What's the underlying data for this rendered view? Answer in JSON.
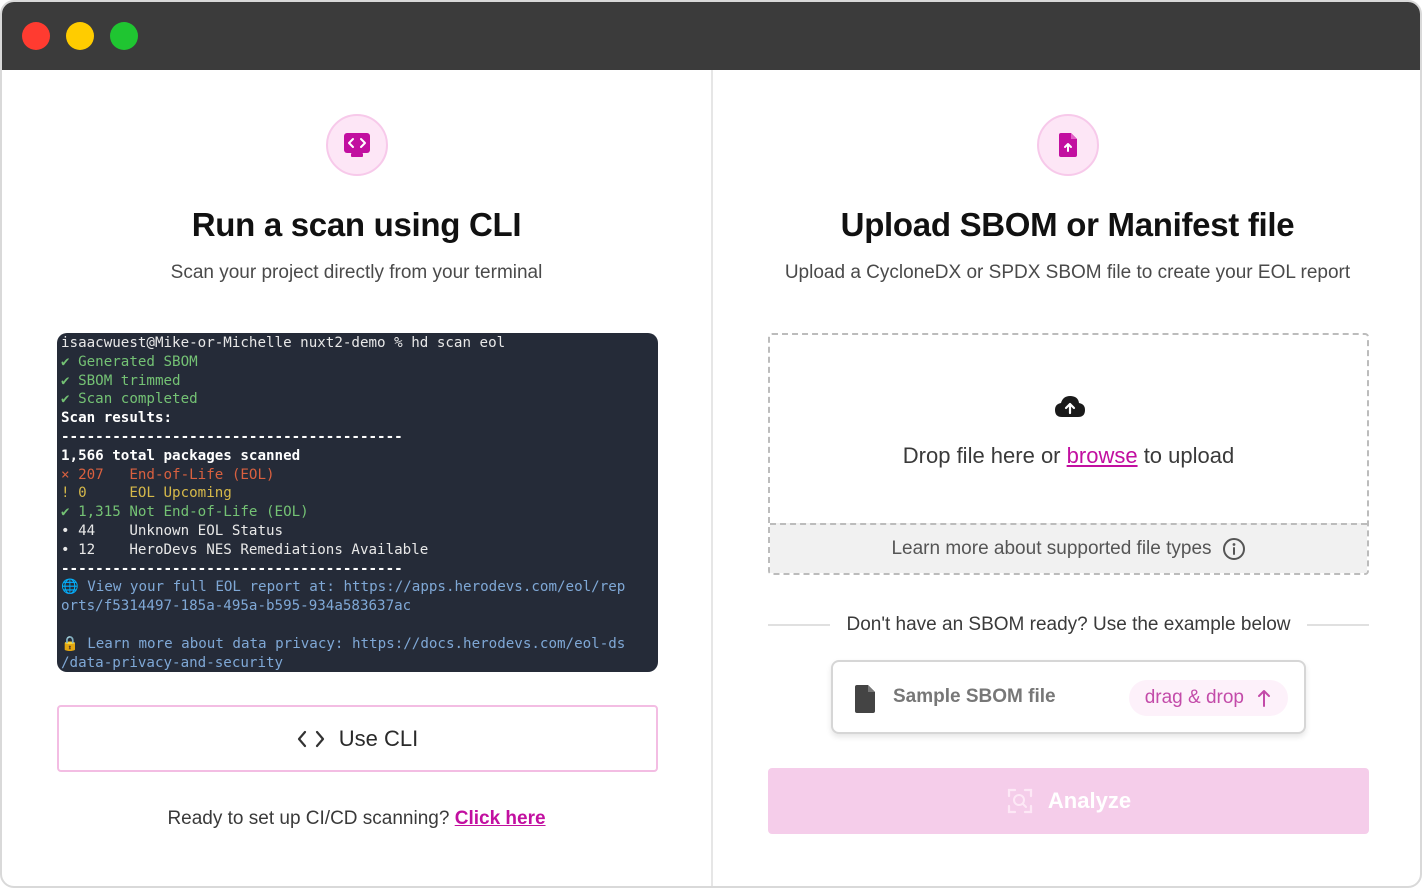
{
  "colors": {
    "accent": "#c20fa0",
    "accent_light": "#fde6f6",
    "analyze_disabled": "#f5cdea",
    "titlebar": "#3b3b3b"
  },
  "cli_panel": {
    "icon": "terminal-icon",
    "title": "Run a scan using CLI",
    "subtitle": "Scan your project directly from your terminal",
    "terminal_lines": [
      "isaacwuest@Mike-or-Michelle nuxt2-demo % hd scan eol",
      "✔ Generated SBOM",
      "✔ SBOM trimmed",
      "✔ Scan completed",
      "Scan results:",
      "----------------------------------------",
      "1,566 total packages scanned",
      "× 207   End-of-Life (EOL)",
      "! 0     EOL Upcoming",
      "✔ 1,315 Not End-of-Life (EOL)",
      "• 44    Unknown EOL Status",
      "• 12    HeroDevs NES Remediations Available",
      "----------------------------------------",
      "🌐 View your full EOL report at: https://apps.herodevs.com/eol/rep",
      "orts/f5314497-185a-495a-b595-934a583637ac",
      "",
      "🔒 Learn more about data privacy: https://docs.herodevs.com/eol-ds",
      "/data-privacy-and-security"
    ],
    "use_cli_label": "Use CLI",
    "cicd_prompt": "Ready to set up CI/CD scanning?",
    "cicd_link": "Click here"
  },
  "upload_panel": {
    "icon": "file-upload-icon",
    "title": "Upload SBOM or Manifest file",
    "subtitle": "Upload a CycloneDX or SPDX SBOM file to create your EOL report",
    "drop_prefix": "Drop file here or",
    "drop_link": "browse",
    "drop_suffix": "to upload",
    "supported_types": "Learn more about supported file types",
    "separator_text": "Don't have an SBOM ready? Use the example below",
    "sample_label": "Sample SBOM file",
    "drag_drop_label": "drag & drop",
    "analyze_label": "Analyze"
  }
}
